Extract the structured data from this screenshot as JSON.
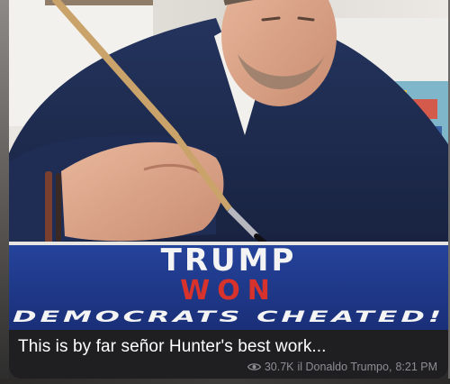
{
  "post": {
    "sign": {
      "line1": "TRUMP",
      "line2": "WON",
      "line3": "DEMOCRATS CHEATED!"
    },
    "caption": "This is by far señor Hunter's best work...",
    "views": "30.7K",
    "author": "il Donaldo Trumpo",
    "time": "8:21 PM",
    "separator": ","
  },
  "colors": {
    "sign_background": "#1f3b8f",
    "sign_text_white": "#f4f4f4",
    "sign_text_red": "#d8322c",
    "caption_text": "#ffffff",
    "meta_text": "#8e8e93"
  },
  "icons": {
    "views": "eye-icon"
  }
}
